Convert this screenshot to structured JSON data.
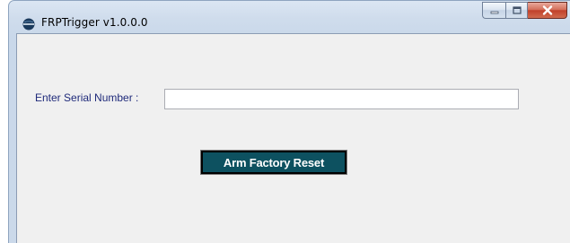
{
  "window": {
    "title": "FRPTrigger v1.0.0.0",
    "icon": "globe-app-icon",
    "controls": {
      "minimize_icon": "minimize-icon",
      "maximize_icon": "maximize-icon",
      "close_icon": "close-icon"
    }
  },
  "form": {
    "serial_label": "Enter Serial Number :",
    "serial_value": "",
    "arm_button_label": "Arm Factory Reset"
  },
  "colors": {
    "button_bg": "#0d5160",
    "label_text": "#1f2a7a",
    "client_bg": "#f0f0f0",
    "close_red": "#c1412b"
  }
}
